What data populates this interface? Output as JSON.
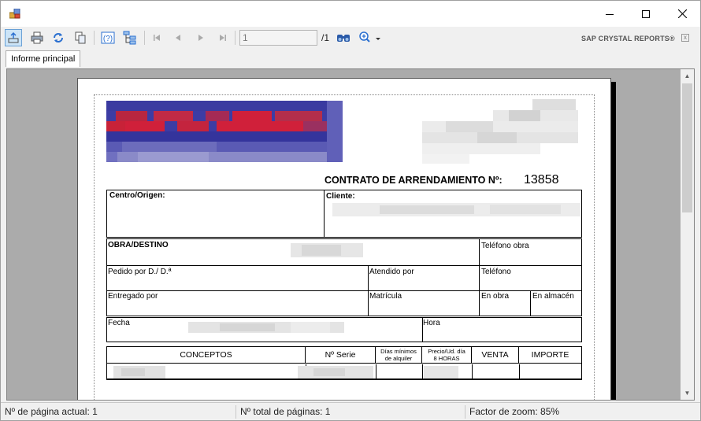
{
  "window": {
    "close_glyph": "✕",
    "minimize_glyph": "—",
    "maximize_glyph": "☐"
  },
  "toolbar": {
    "page_input_value": "1",
    "page_total": "/1",
    "brand": "SAP CRYSTAL REPORTS®",
    "brand_close_glyph": "x",
    "icons": [
      "export-icon",
      "print-icon",
      "refresh-icon",
      "copy-icon",
      "help-icon",
      "group-tree-icon",
      "first-page-icon",
      "previous-page-icon",
      "next-page-icon",
      "last-page-icon",
      "find-icon",
      "zoom-icon"
    ]
  },
  "tabs": [
    {
      "label": "Informe principal"
    }
  ],
  "report": {
    "title": "CONTRATO DE ARRENDAMIENTO Nº:",
    "number": "13858",
    "fields": {
      "centro_origen": "Centro/Origen:",
      "cliente": "Cliente:",
      "obra_destino": "OBRA/DESTINO",
      "telefono_obra": "Teléfono obra",
      "pedido_por": "Pedido por D./ D.ª",
      "atendido_por": "Atendido por",
      "telefono": "Teléfono",
      "entregado_por": "Entregado por",
      "matricula": "Matrícula",
      "en_obra": "En obra",
      "en_almacen": "En almacén",
      "fecha": "Fecha",
      "hora": "Hora"
    },
    "table_headers": {
      "conceptos": "CONCEPTOS",
      "serie": "Nº Serie",
      "dias_1": "Días mínimos",
      "dias_2": "de alquiler",
      "precio_1": "Precio/Ud. día",
      "precio_2": "8 HORAS",
      "venta": "VENTA",
      "importe": "IMPORTE"
    }
  },
  "status": {
    "current_page": "Nº de página actual: 1",
    "total_pages": "Nº total de páginas: 1",
    "zoom": "Factor de zoom: 85%"
  },
  "colors": {
    "logo_blue": "#3a3a9e",
    "logo_red": "#d0203a",
    "selection_blue": "#cce4f7"
  }
}
